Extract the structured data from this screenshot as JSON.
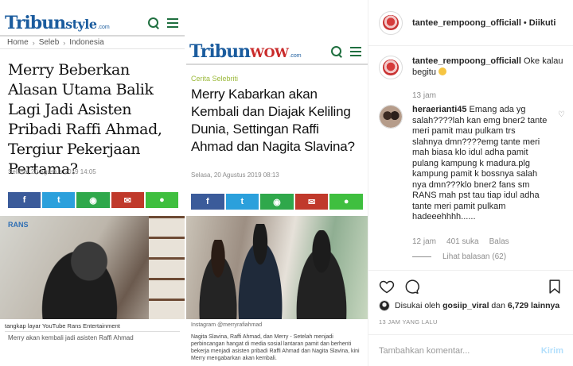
{
  "article1": {
    "logo_main": "Tribun",
    "logo_word": "style",
    "logo_domain": ".com",
    "breadcrumb": [
      "Home",
      "Seleb",
      "Indonesia"
    ],
    "headline": "Merry Beberkan Alasan Utama Balik Lagi Jadi Asisten Pribadi Raffi Ahmad, Tergiur Pekerjaan Pertama?",
    "date": "Selasa, 20 Agustus 2019 14:05",
    "photo_brand": "RANS",
    "caption_source": "tangkap layar YouTube Rans Entertainment",
    "caption_text": "Merry akan kembali jadi asisten Raffi Ahmad"
  },
  "article2": {
    "logo_main": "Tribun",
    "logo_word": "WOW",
    "logo_domain": ".com",
    "topic": "Cerita Selebriti",
    "headline": "Merry Kabarkan akan Kembali dan Diajak Keliling Dunia, Settingan Raffi Ahmad dan Nagita Slavina?",
    "date": "Selasa, 20 Agustus 2019 08:13",
    "caption_source": "Instagram @merryrafiahmad",
    "caption_text": "Nagita Slavina, Raffi Ahmad, dan Merry - Setelah menjadi perbincangan hangat di media sosial lantaran pamit dan berhenti bekerja menjadi asisten pribadi Raffi Ahmad dan Nagita Slavina, kini Merry mengabarkan akan kembali."
  },
  "instagram": {
    "header": {
      "username": "tantee_rempoong_officiall",
      "separator": "•",
      "follow_label": "Diikuti"
    },
    "caption": {
      "username": "tantee_rempoong_officiall",
      "text": "Oke kalau begitu",
      "time": "13 jam"
    },
    "comment": {
      "username": "heraerianti45",
      "text": "Emang ada yg salah????lah kan emg bner2 tante meri pamit mau pulkam trs slahnya dmn????emg tante meri mah biasa klo idul adha pamit pulang kampung k madura.plg kampung pamit k bossnya salah nya dmn???klo bner2 fans sm RANS mah pst tau tiap idul adha tante meri pamit pulkam hadeeehhhh......",
      "time": "12 jam",
      "likes": "401 suka",
      "reply_label": "Balas",
      "view_replies": "Lihat balasan (62)"
    },
    "liked_by": {
      "prefix": "Disukai oleh",
      "user": "gosiip_viral",
      "middle": "dan",
      "others": "6,729 lainnya"
    },
    "time_ago": "13 JAM YANG LALU",
    "add_comment": {
      "placeholder": "Tambahkan komentar...",
      "post_label": "Kirim"
    }
  }
}
